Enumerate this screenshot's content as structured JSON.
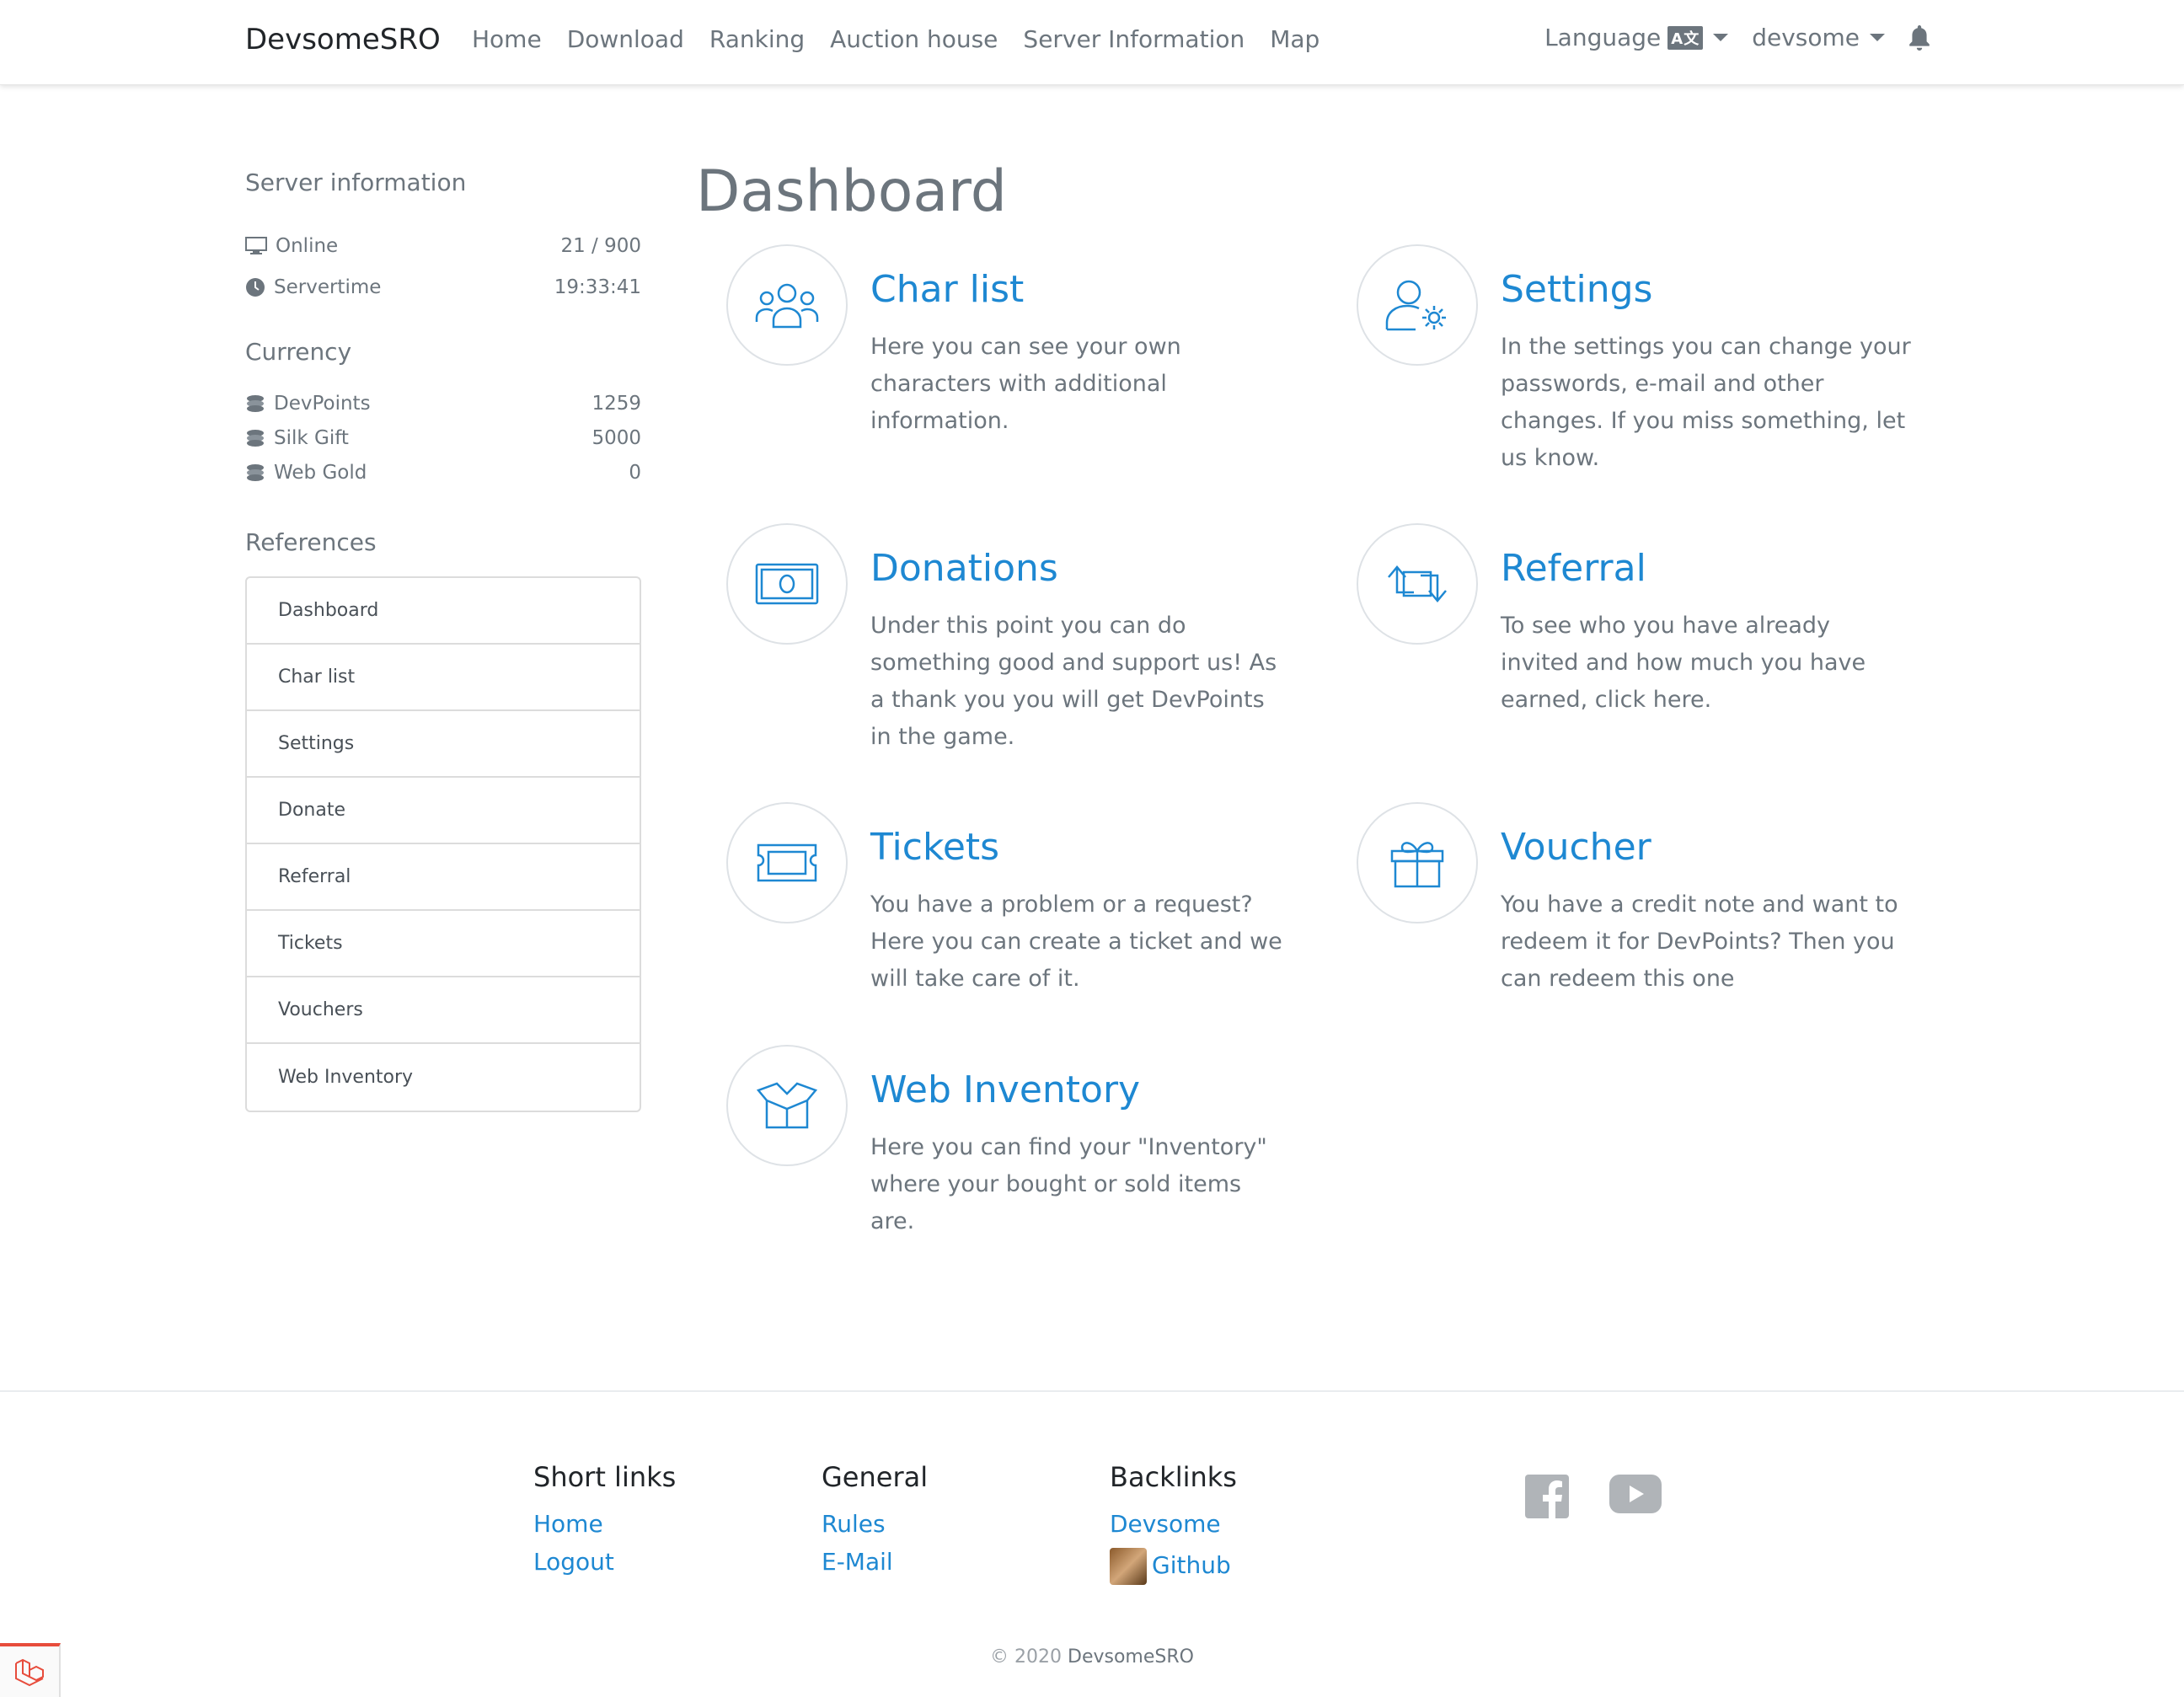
{
  "navbar": {
    "brand": "DevsomeSRO",
    "links": [
      "Home",
      "Download",
      "Ranking",
      "Auction house",
      "Server Information",
      "Map"
    ],
    "language_label": "Language",
    "user_label": "devsome"
  },
  "sidebar": {
    "server_info_heading": "Server information",
    "online_label": "Online",
    "online_value": "21 / 900",
    "servertime_label": "Servertime",
    "servertime_value": "19:33:41",
    "currency_heading": "Currency",
    "currencies": [
      {
        "label": "DevPoints",
        "value": "1259"
      },
      {
        "label": "Silk Gift",
        "value": "5000"
      },
      {
        "label": "Web Gold",
        "value": "0"
      }
    ],
    "references_heading": "References",
    "references": [
      "Dashboard",
      "Char list",
      "Settings",
      "Donate",
      "Referral",
      "Tickets",
      "Vouchers",
      "Web Inventory"
    ]
  },
  "main": {
    "title": "Dashboard",
    "cards": [
      {
        "title": "Char list",
        "desc": "Here you can see your own characters with additional information.",
        "icon": "users-icon"
      },
      {
        "title": "Settings",
        "desc": "In the settings you can change your passwords, e-mail and other changes. If you miss something, let us know.",
        "icon": "user-settings-icon"
      },
      {
        "title": "Donations",
        "desc": "Under this point you can do something good and support us! As a thank you you will get DevPoints in the game.",
        "icon": "money-icon"
      },
      {
        "title": "Referral",
        "desc": "To see who you have already invited and how much you have earned, click here.",
        "icon": "exchange-icon"
      },
      {
        "title": "Tickets",
        "desc": "You have a problem or a request? Here you can create a ticket and we will take care of it.",
        "icon": "ticket-icon"
      },
      {
        "title": "Voucher",
        "desc": "You have a credit note and want to redeem it for DevPoints? Then you can redeem this one",
        "icon": "gift-icon"
      },
      {
        "title": "Web Inventory",
        "desc": "Here you can find your \"Inventory\" where your bought or sold items are.",
        "icon": "box-icon"
      }
    ]
  },
  "footer": {
    "short_links": {
      "heading": "Short links",
      "links": [
        "Home",
        "Logout"
      ]
    },
    "general": {
      "heading": "General",
      "links": [
        "Rules",
        "E-Mail"
      ]
    },
    "backlinks": {
      "heading": "Backlinks",
      "links": [
        "Devsome",
        "Github"
      ]
    },
    "copyright_prefix": "© 2020",
    "copyright_brand": "DevsomeSRO"
  },
  "colors": {
    "accent": "#1e88d2",
    "muted": "#6c757d",
    "laravel": "#e74c3c"
  }
}
